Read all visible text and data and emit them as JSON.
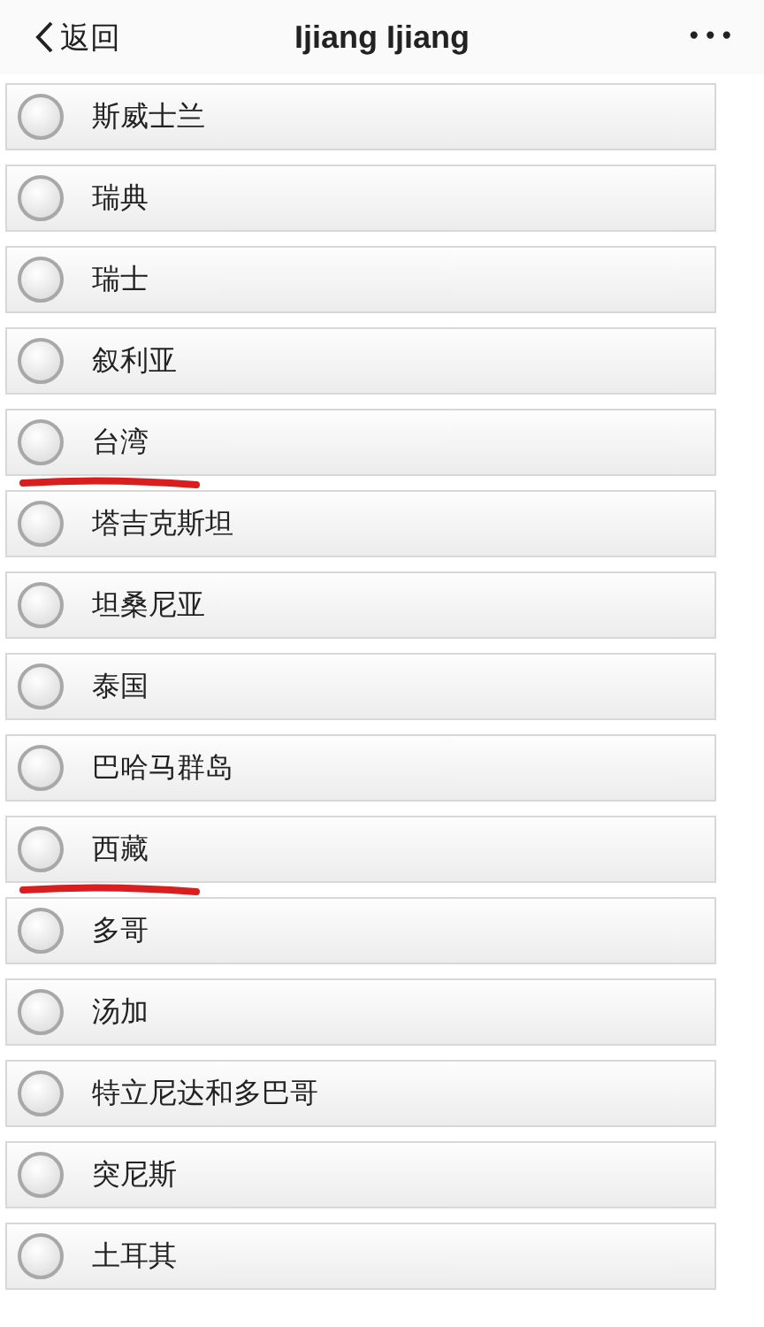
{
  "header": {
    "back": "返回",
    "title": "Ijiang Ijiang",
    "more": "•••"
  },
  "options": [
    {
      "label": "斯威士兰",
      "selected": false,
      "underlined": false
    },
    {
      "label": "瑞典",
      "selected": false,
      "underlined": false
    },
    {
      "label": "瑞士",
      "selected": false,
      "underlined": false
    },
    {
      "label": "叙利亚",
      "selected": false,
      "underlined": false
    },
    {
      "label": "台湾",
      "selected": false,
      "underlined": true
    },
    {
      "label": "塔吉克斯坦",
      "selected": false,
      "underlined": false
    },
    {
      "label": "坦桑尼亚",
      "selected": false,
      "underlined": false
    },
    {
      "label": "泰国",
      "selected": false,
      "underlined": false
    },
    {
      "label": "巴哈马群岛",
      "selected": false,
      "underlined": false
    },
    {
      "label": "西藏",
      "selected": false,
      "underlined": true
    },
    {
      "label": "多哥",
      "selected": false,
      "underlined": false
    },
    {
      "label": "汤加",
      "selected": false,
      "underlined": false
    },
    {
      "label": "特立尼达和多巴哥",
      "selected": false,
      "underlined": false
    },
    {
      "label": "突尼斯",
      "selected": false,
      "underlined": false
    },
    {
      "label": "土耳其",
      "selected": false,
      "underlined": false
    }
  ]
}
